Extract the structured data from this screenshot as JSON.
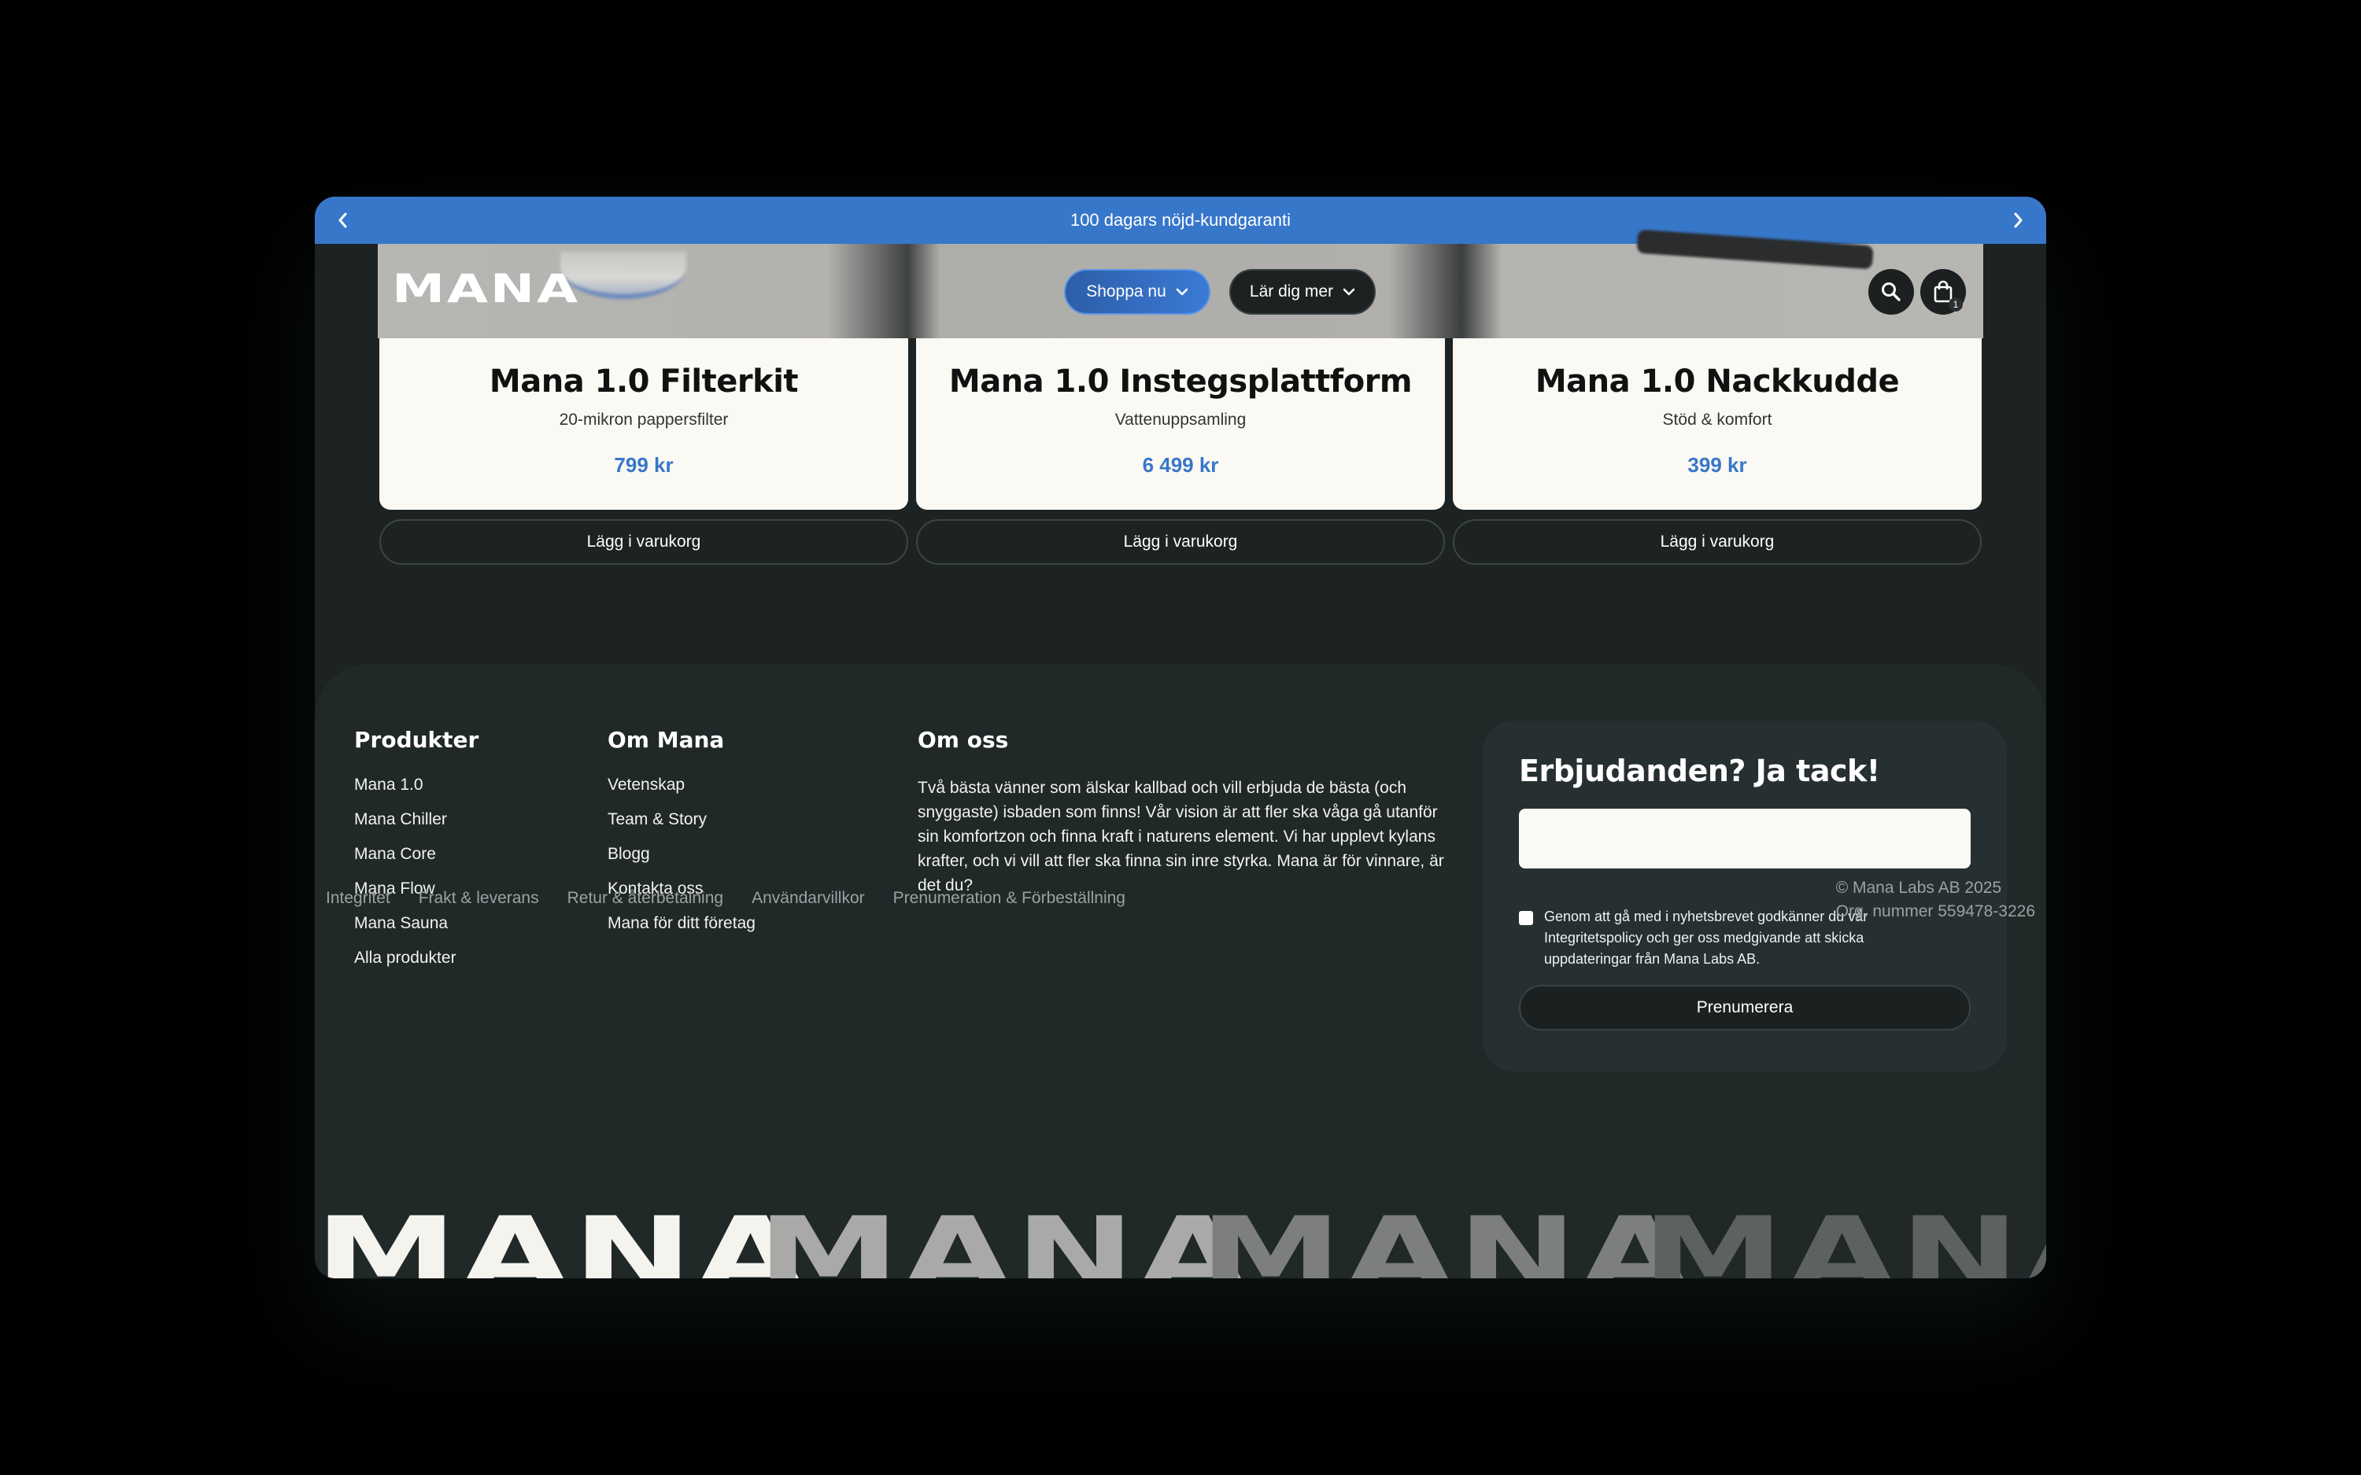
{
  "announcement": {
    "text": "100 dagars nöjd-kundgaranti"
  },
  "header": {
    "logo": "MANA",
    "nav": [
      {
        "label": "Shoppa nu"
      },
      {
        "label": "Lär dig mer"
      }
    ],
    "cart_count": "1"
  },
  "products": [
    {
      "name": "Mana 1.0 Filterkit",
      "subtitle": "20-mikron pappersfilter",
      "price": "799 kr",
      "button": "Lägg i varukorg"
    },
    {
      "name": "Mana 1.0 Instegsplattform",
      "subtitle": "Vattenuppsamling",
      "price": "6 499 kr",
      "button": "Lägg i varukorg"
    },
    {
      "name": "Mana 1.0 Nackkudde",
      "subtitle": "Stöd & komfort",
      "price": "399 kr",
      "button": "Lägg i varukorg"
    }
  ],
  "footer": {
    "products": {
      "title": "Produkter",
      "items": [
        "Mana 1.0",
        "Mana Chiller",
        "Mana Core",
        "Mana Flow",
        "Mana Sauna",
        "Alla produkter"
      ]
    },
    "about_mana": {
      "title": "Om Mana",
      "items": [
        "Vetenskap",
        "Team & Story",
        "Blogg",
        "Kontakta oss",
        "Mana för ditt företag"
      ]
    },
    "about_us": {
      "title": "Om oss",
      "text": "Två bästa vänner som älskar kallbad och vill erbjuda de bästa (och snyggaste) isbaden som finns! Vår vision är att fler ska våga gå utanför sin komfortzon och finna kraft i naturens element. Vi har upplevt kylans krafter, och vi vill att fler ska finna sin inre styrka. Mana är för vinnare, är det du?"
    },
    "newsletter": {
      "title": "Erbjudanden? Ja tack!",
      "email_value": "",
      "consent": "Genom att gå med i nyhetsbrevet godkänner du vår Integritetspolicy och ger oss medgivande att skicka uppdateringar från Mana Labs AB.",
      "button": "Prenumerera"
    },
    "legal_links": [
      "Integritet",
      "Frakt & leverans",
      "Retur & återbetalning",
      "Användarvillkor",
      "Prenumeration & Förbeställning"
    ],
    "copyright": "© Mana Labs AB 2025",
    "org_number": "Org. nummer 559478-3226",
    "wordmark": "MANA"
  }
}
